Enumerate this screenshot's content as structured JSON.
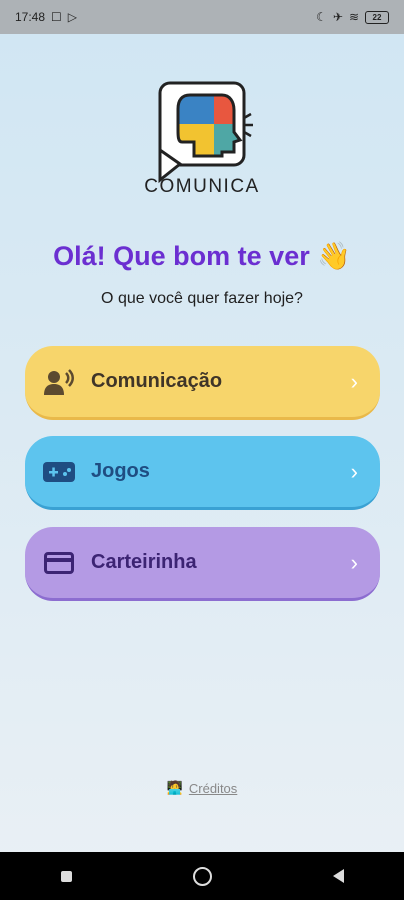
{
  "status": {
    "time": "17:48",
    "battery": "22"
  },
  "app": {
    "name": "COMUNICA"
  },
  "greeting": "Olá! Que bom te ver 👋",
  "subtitle": "O que você quer fazer hoje?",
  "menu": [
    {
      "label": "Comunicação",
      "icon": "speaking-person-icon",
      "color": "#f7d56b"
    },
    {
      "label": "Jogos",
      "icon": "gamepad-icon",
      "color": "#5dc4ee"
    },
    {
      "label": "Carteirinha",
      "icon": "card-icon",
      "color": "#b49ae4"
    }
  ],
  "credits": {
    "emoji": "🧑‍💻",
    "label": "Créditos"
  }
}
